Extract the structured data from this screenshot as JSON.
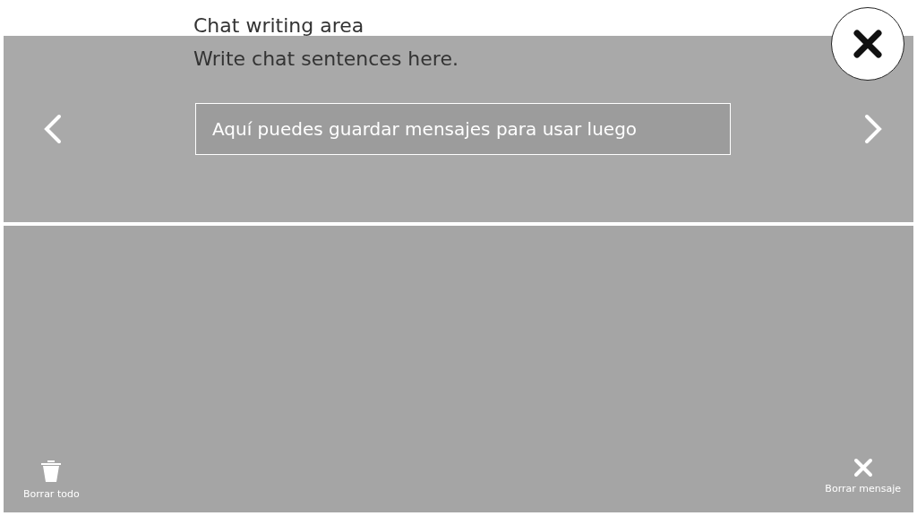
{
  "tutorial": {
    "title": "Chat writing area",
    "description": "Write chat sentences here."
  },
  "app": {
    "saved_messages": {
      "placeholder": "Aquí puedes guardar mensajes para usar luego"
    },
    "actions": [
      {
        "kind": "trash",
        "label": "Borrar todo"
      },
      {
        "kind": "close",
        "label": "Borrar mensaje"
      }
    ]
  }
}
